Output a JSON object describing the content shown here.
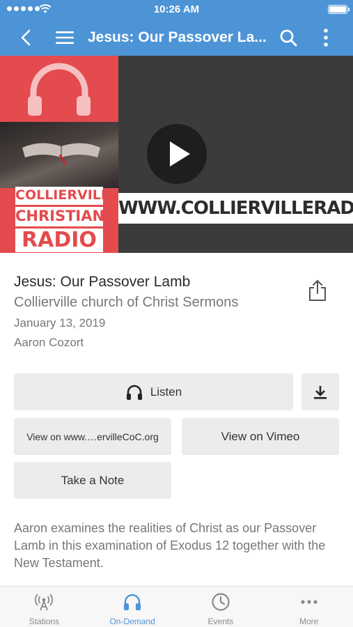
{
  "status_bar": {
    "time": "10:26 AM"
  },
  "nav": {
    "title": "Jesus: Our Passover La..."
  },
  "media": {
    "logo_lines": [
      "COLLIERVILLE",
      "CHRISTIAN",
      "RADIO"
    ],
    "url_text": "WWW.COLLIERVILLERADIO.COM"
  },
  "sermon": {
    "title": "Jesus: Our Passover Lamb",
    "series": "Collierville church of Christ Sermons",
    "date": "January 13, 2019",
    "speaker": "Aaron Cozort"
  },
  "actions": {
    "listen_label": "Listen",
    "web_label": "View on www.…ervilleCoC.org",
    "vimeo_label": "View on Vimeo",
    "note_label": "Take a Note"
  },
  "description": "Aaron examines the realities of Christ as our Passover Lamb in this examination of Exodus 12 together with the New Testament.",
  "tabs": [
    {
      "label": "Stations",
      "icon": "antenna-icon"
    },
    {
      "label": "On-Demand",
      "icon": "headphones-icon"
    },
    {
      "label": "Events",
      "icon": "clock-icon"
    },
    {
      "label": "More",
      "icon": "more-dots-icon"
    }
  ],
  "colors": {
    "accent": "#4d94d6",
    "logo_red": "#e34b4e",
    "button_bg": "#ececec"
  }
}
